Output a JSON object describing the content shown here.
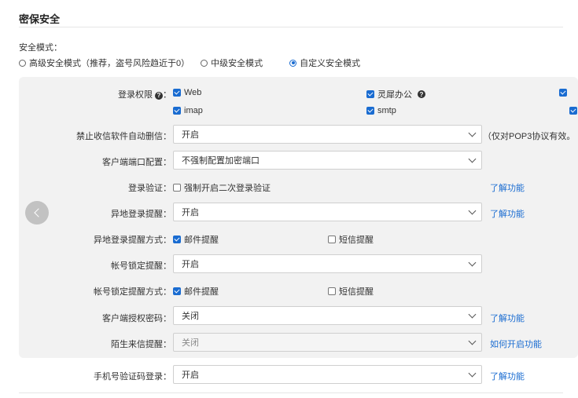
{
  "section_title": "密保安全",
  "mode": {
    "label": "安全模式：",
    "options": [
      {
        "label": "高级安全模式（推荐，盗号风险趋近于0）",
        "selected": false
      },
      {
        "label": "中级安全模式",
        "selected": false
      },
      {
        "label": "自定义安全模式",
        "selected": true
      }
    ]
  },
  "login_permission": {
    "label": "登录权限",
    "colon": "：",
    "options": [
      {
        "label": "Web",
        "checked": true
      },
      {
        "label": "灵犀办公",
        "checked": true,
        "help": true
      },
      {
        "label": "imap",
        "checked": true
      },
      {
        "label": "smtp",
        "checked": true
      }
    ]
  },
  "auto_delete": {
    "label": "禁止收信软件自动删信：",
    "value": "开启",
    "note": "（仅对POP3协议有效。"
  },
  "client_port": {
    "label": "客户端端口配置：",
    "value": "不强制配置加密端口"
  },
  "login_verify": {
    "label": "登录验证：",
    "option": "强制开启二次登录验证",
    "checked": false,
    "link": "了解功能"
  },
  "remote_login_alert": {
    "label": "异地登录提醒：",
    "value": "开启",
    "link": "了解功能"
  },
  "remote_login_method": {
    "label": "异地登录提醒方式：",
    "options": [
      {
        "label": "邮件提醒",
        "checked": true
      },
      {
        "label": "短信提醒",
        "checked": false
      }
    ]
  },
  "account_lock_alert": {
    "label": "帐号锁定提醒：",
    "value": "开启"
  },
  "account_lock_method": {
    "label": "帐号锁定提醒方式：",
    "options": [
      {
        "label": "邮件提醒",
        "checked": true
      },
      {
        "label": "短信提醒",
        "checked": false
      }
    ]
  },
  "client_auth_password": {
    "label": "客户端授权密码：",
    "value": "关闭",
    "link": "了解功能"
  },
  "stranger_mail_alert": {
    "label": "陌生来信提醒：",
    "value": "关闭",
    "link": "如何开启功能",
    "disabled": true
  },
  "phone_code_login": {
    "label": "手机号验证码登录：",
    "value": "开启",
    "link": "了解功能"
  },
  "colors": {
    "accent": "#1a6cd1",
    "panel_bg": "#f2f2f2"
  }
}
